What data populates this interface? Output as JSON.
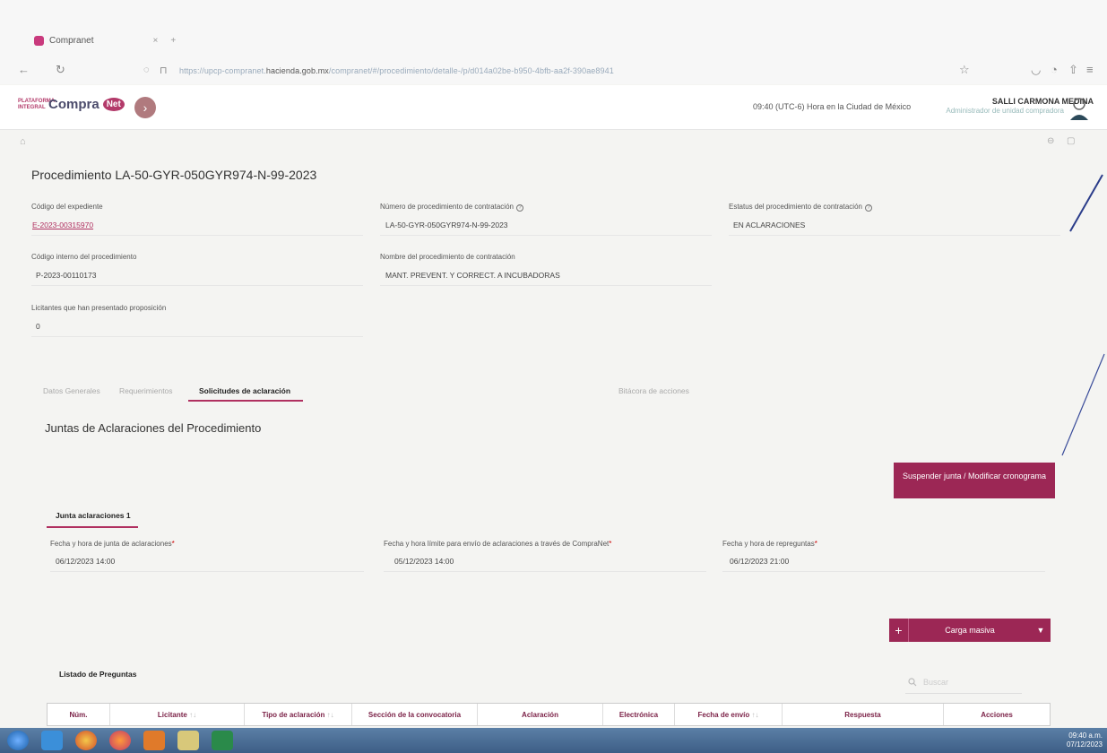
{
  "browser": {
    "tab_title": "Compranet",
    "url_prefix": "https://upcp-compranet.",
    "url_domain": "hacienda.gob.mx",
    "url_suffix": "/compranet/#/procedimiento/detalle-/p/d014a02be-b950-4bfb-aa2f-390ae8941"
  },
  "header": {
    "logo_small": "PLATAFORMA INTEGRAL",
    "logo_text": "Compra",
    "logo_net": "Net",
    "clock": "09:40 (UTC-6) Hora en la Ciudad de México",
    "user_name": "SALLI CARMONA MEDINA",
    "user_role": "Administrador de unidad compradora"
  },
  "page": {
    "title": "Procedimiento LA-50-GYR-050GYR974-N-99-2023"
  },
  "fields": {
    "codigo_expediente_label": "Código del expediente",
    "codigo_expediente_value": "E-2023-00315970",
    "numero_proc_label": "Número de procedimiento de contratación",
    "numero_proc_value": "LA-50-GYR-050GYR974-N-99-2023",
    "estatus_label": "Estatus del procedimiento de contratación",
    "estatus_value": "EN ACLARACIONES",
    "codigo_interno_label": "Código interno del procedimiento",
    "codigo_interno_value": "P-2023-00110173",
    "nombre_proc_label": "Nombre del procedimiento de contratación",
    "nombre_proc_value": "MANT. PREVENT. Y CORRECT. A INCUBADORAS",
    "licitantes_label": "Licitantes que han presentado proposición",
    "licitantes_value": "0"
  },
  "tabs": [
    {
      "label": "Datos Generales"
    },
    {
      "label": "Requerimientos"
    },
    {
      "label": "Solicitudes de aclaración"
    },
    {
      "label": "Bitácora de acciones"
    }
  ],
  "juntas": {
    "title": "Juntas de Aclaraciones del Procedimiento",
    "suspend_button": "Suspender junta / Modificar cronograma",
    "junta_tab": "Junta aclaraciones 1",
    "fecha_junta_label": "Fecha y hora de junta de aclaraciones",
    "fecha_junta_value": "06/12/2023 14:00",
    "fecha_limite_label": "Fecha y hora límite para envío de aclaraciones a través de CompraNet",
    "fecha_limite_value": "05/12/2023 14:00",
    "fecha_repreguntas_label": "Fecha y hora de repreguntas",
    "fecha_repreguntas_value": "06/12/2023 21:00"
  },
  "carga_masiva": "Carga masiva",
  "listado": {
    "title": "Listado de Preguntas",
    "search_placeholder": "Buscar",
    "columns": [
      "Núm.",
      "Licitante",
      "Tipo de aclaración",
      "Sección de la convocatoria",
      "Aclaración",
      "Electrónica",
      "Fecha de envío",
      "Respuesta",
      "Acciones"
    ]
  },
  "taskbar": {
    "time": "09:40 a.m.",
    "date": "07/12/2023"
  },
  "colors": {
    "accent": "#9c2755",
    "link": "#b03060",
    "taskbar": "#4a6d96"
  }
}
